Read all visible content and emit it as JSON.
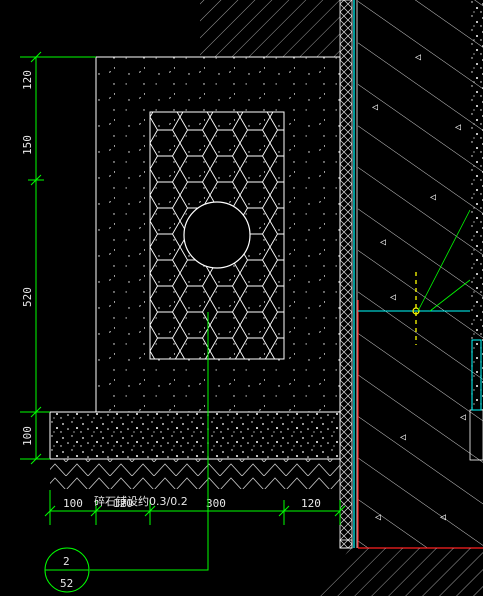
{
  "dimensions": {
    "vertical": [
      "120",
      "150",
      "520",
      "100"
    ],
    "horizontal": [
      "100",
      "120",
      "300",
      "120"
    ]
  },
  "note_text": "碎石铺设约0.3/0.2",
  "detail_callout": {
    "number": "2",
    "sheet": "52"
  },
  "colors": {
    "background": "#000000",
    "dimension_line": "#00ff00",
    "linework": "#ffffff",
    "hatch": "#c8c8c8",
    "waterproof_layer": "#00ffff",
    "membrane_red": "#ff2020",
    "yellow_marker": "#ffff00"
  }
}
